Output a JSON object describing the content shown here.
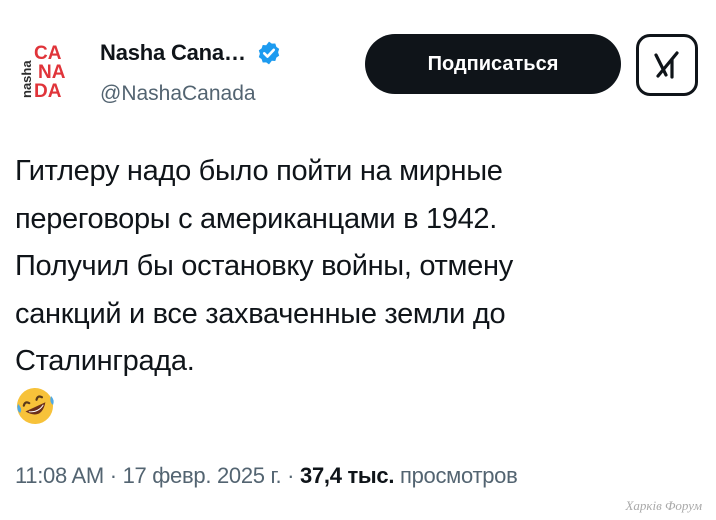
{
  "account": {
    "avatar_lines": [
      "CA",
      "NA",
      "DA"
    ],
    "avatar_side_text": "nasha",
    "display_name": "Nasha Cana…",
    "handle": "@NashaCanada",
    "verified_icon": "verified-badge-icon"
  },
  "actions": {
    "follow_label": "Подписаться",
    "grok_icon": "grok-icon"
  },
  "tweet": {
    "lines": [
      "Гитлеру надо было пойти на мирные",
      "переговоры с американцами в 1942.",
      "Получил бы остановку войны, отмену",
      "санкций и все захваченные земли до",
      "Сталинграда."
    ],
    "emoji": "rolling-on-floor-laughing-emoji"
  },
  "meta": {
    "time": "11:08 AM",
    "separator": "·",
    "date": "17 февр. 2025 г.",
    "views_count": "37,4 тыс.",
    "views_label": "просмотров"
  },
  "watermark": "Харків Форум",
  "colors": {
    "text": "#0f1419",
    "secondary": "#536471",
    "verified": "#1d9bf0",
    "avatar_red": "#e0343a",
    "emoji_yellow": "#f7c23a"
  }
}
